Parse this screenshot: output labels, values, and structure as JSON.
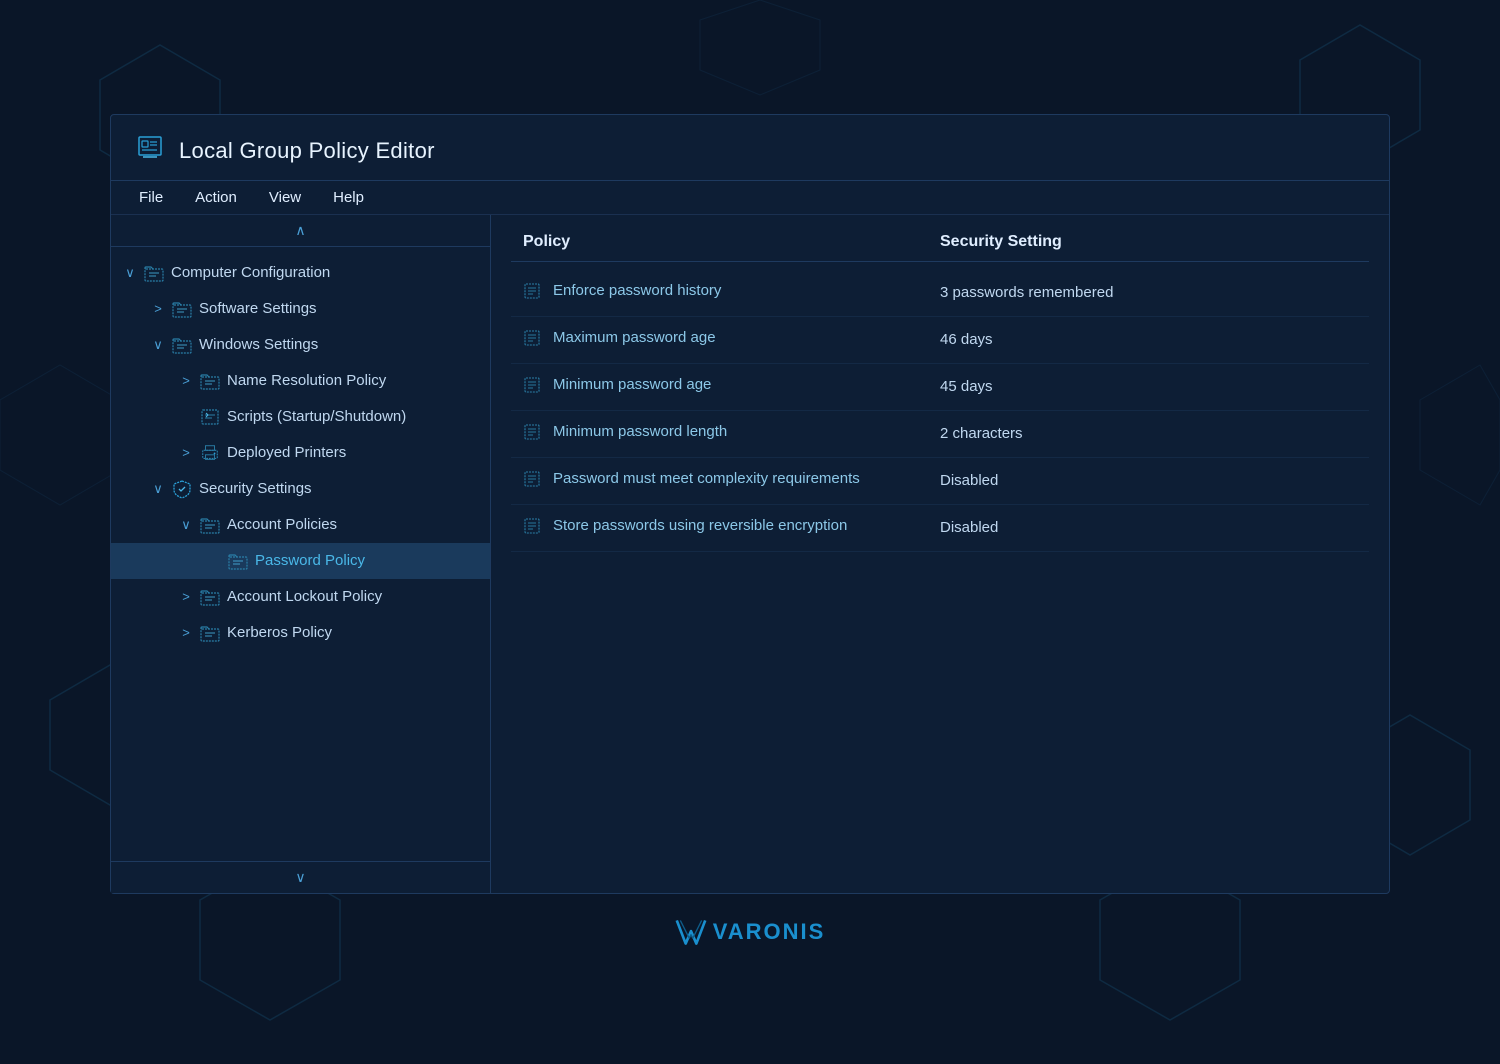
{
  "app": {
    "title": "Local Group Policy Editor",
    "menu": [
      "File",
      "Action",
      "View",
      "Help"
    ]
  },
  "tree": {
    "items": [
      {
        "id": "computer-config",
        "label": "Computer Configuration",
        "indent": 0,
        "expander": "∨",
        "type": "folder"
      },
      {
        "id": "software-settings",
        "label": "Software Settings",
        "indent": 1,
        "expander": ">",
        "type": "folder"
      },
      {
        "id": "windows-settings",
        "label": "Windows Settings",
        "indent": 1,
        "expander": "∨",
        "type": "folder"
      },
      {
        "id": "name-resolution",
        "label": "Name Resolution Policy",
        "indent": 2,
        "expander": ">",
        "type": "folder"
      },
      {
        "id": "scripts",
        "label": "Scripts (Startup/Shutdown)",
        "indent": 2,
        "expander": "",
        "type": "script"
      },
      {
        "id": "deployed-printers",
        "label": "Deployed Printers",
        "indent": 2,
        "expander": ">",
        "type": "printer"
      },
      {
        "id": "security-settings",
        "label": "Security Settings",
        "indent": 1,
        "expander": "∨",
        "type": "shield"
      },
      {
        "id": "account-policies",
        "label": "Account Policies",
        "indent": 2,
        "expander": "∨",
        "type": "folder"
      },
      {
        "id": "password-policy",
        "label": "Password Policy",
        "indent": 3,
        "expander": "",
        "type": "folder",
        "selected": true
      },
      {
        "id": "account-lockout",
        "label": "Account Lockout Policy",
        "indent": 2,
        "expander": ">",
        "type": "folder"
      },
      {
        "id": "kerberos",
        "label": "Kerberos Policy",
        "indent": 2,
        "expander": ">",
        "type": "folder"
      }
    ]
  },
  "table": {
    "col_policy": "Policy",
    "col_security": "Security Setting",
    "rows": [
      {
        "name": "Enforce password history",
        "value": "3 passwords remembered"
      },
      {
        "name": "Maximum password age",
        "value": "46 days"
      },
      {
        "name": "Minimum password age",
        "value": "45 days"
      },
      {
        "name": "Minimum password length",
        "value": "2 characters"
      },
      {
        "name": "Password must meet complexity requirements",
        "value": "Disabled"
      },
      {
        "name": "Store passwords using reversible encryption",
        "value": "Disabled"
      }
    ]
  },
  "branding": {
    "logo_text": "VARONIS"
  }
}
